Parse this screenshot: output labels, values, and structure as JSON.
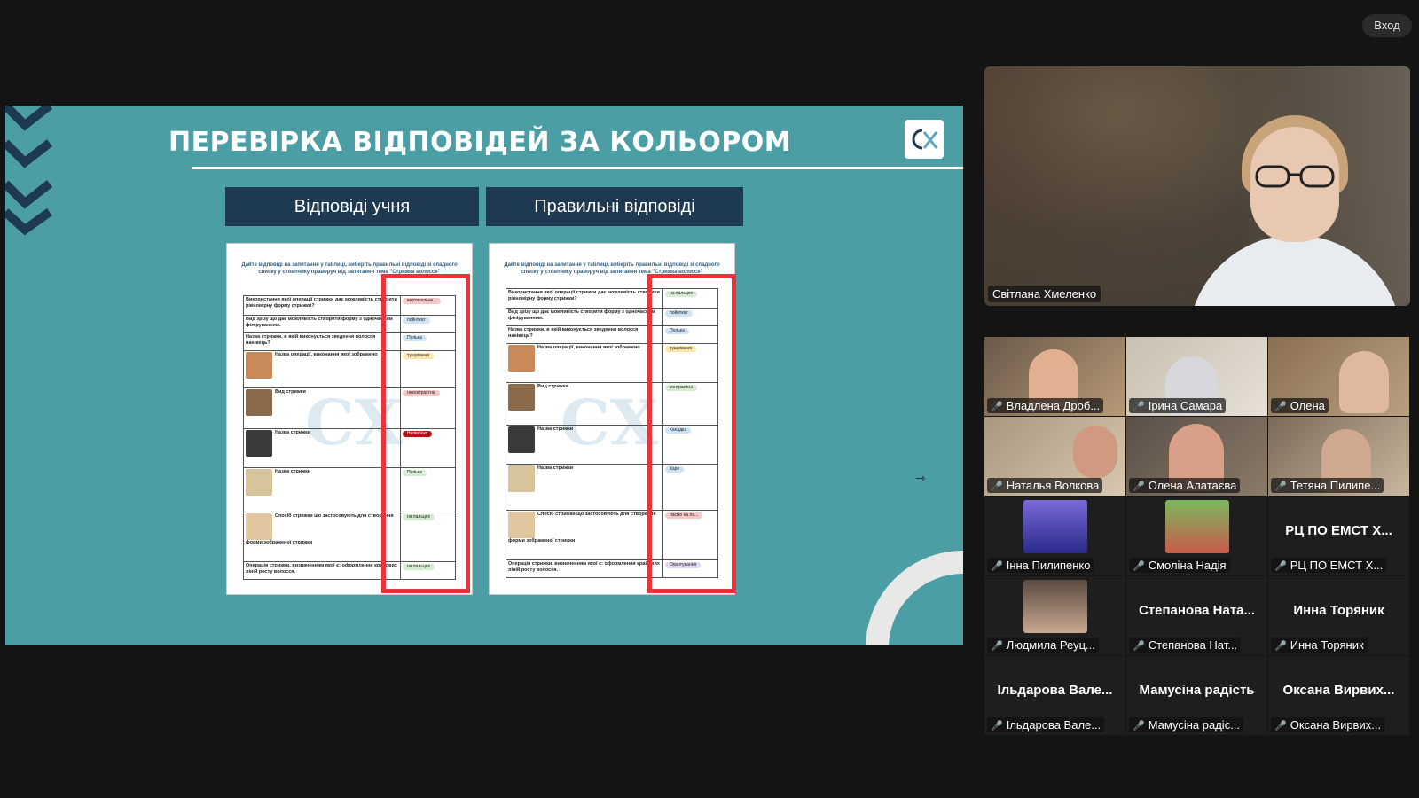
{
  "top_button": "Вход",
  "slide": {
    "title": "ПЕРЕВІРКА ВІДПОВІДЕЙ ЗА КОЛЬОРОМ",
    "col_left": "Відповіді учня",
    "col_right": "Правильні відповіді",
    "instruction": "Дайте відповіді на запитання у таблиці, виберіть правильні відповіді зі спадного списку у стовпчику праворуч від запитання тема \"Стрижка волосся\"",
    "questions": [
      "Використання якої операції стрижки дає можливість створити рівномірну форму стрижки?",
      "Вид зрізу що дає можливість створити форму з одночасним філіруванням.",
      "Назва стрижки, в якій виконується зведення волосся нанівець?",
      "Назва операції, виконання якої зображено",
      "Вид стрижки",
      "Назва стрижки",
      "Назва стрижки",
      "Спосіб стрижки що застосовують для створення форми зображеної стрижки",
      "Операція стрижки, визначенням якої є: оформлення крайових ліній росту волосся."
    ],
    "student_answers": [
      "вертикальне...",
      "пойнткат",
      "Полька",
      "тушування",
      "неконтрастна",
      "Напівбокс",
      "Полька",
      "на пальцях",
      "на пальцях"
    ],
    "correct_answers": [
      "на пальцях",
      "пойнткат",
      "Полька",
      "тушування",
      "контрастна",
      "Канадка",
      "Каре",
      "пасмо на па...",
      "Окантування"
    ]
  },
  "main_speaker": "Світлана Хмеленко",
  "participants": [
    {
      "label": "Владлена Дроб...",
      "big": ""
    },
    {
      "label": "Ірина Самара",
      "big": ""
    },
    {
      "label": "Олена",
      "big": ""
    },
    {
      "label": "Наталья Волкова",
      "big": ""
    },
    {
      "label": "Олена Алатаєва",
      "big": ""
    },
    {
      "label": "Тетяна Пилипе...",
      "big": ""
    },
    {
      "label": "Інна Пилипенко",
      "big": ""
    },
    {
      "label": "Смоліна Надія",
      "big": ""
    },
    {
      "label": "РЦ ПО ЕМСТ Х...",
      "big": "РЦ ПО ЕМСТ Х..."
    },
    {
      "label": "Людмила Реуц...",
      "big": ""
    },
    {
      "label": "Степанова Нат...",
      "big": "Степанова Ната..."
    },
    {
      "label": "Инна Торяник",
      "big": "Инна Торяник"
    },
    {
      "label": "Ільдарова Вале...",
      "big": "Ільдарова Вале..."
    },
    {
      "label": "Мамусіна радіс...",
      "big": "Мамусіна радість"
    },
    {
      "label": "Оксана Вирвих...",
      "big": "Оксана Вирвих..."
    }
  ],
  "colors": {
    "slide_bg": "#4c9ea5",
    "header_bg": "#1e3a52",
    "highlight": "#e8343b"
  }
}
